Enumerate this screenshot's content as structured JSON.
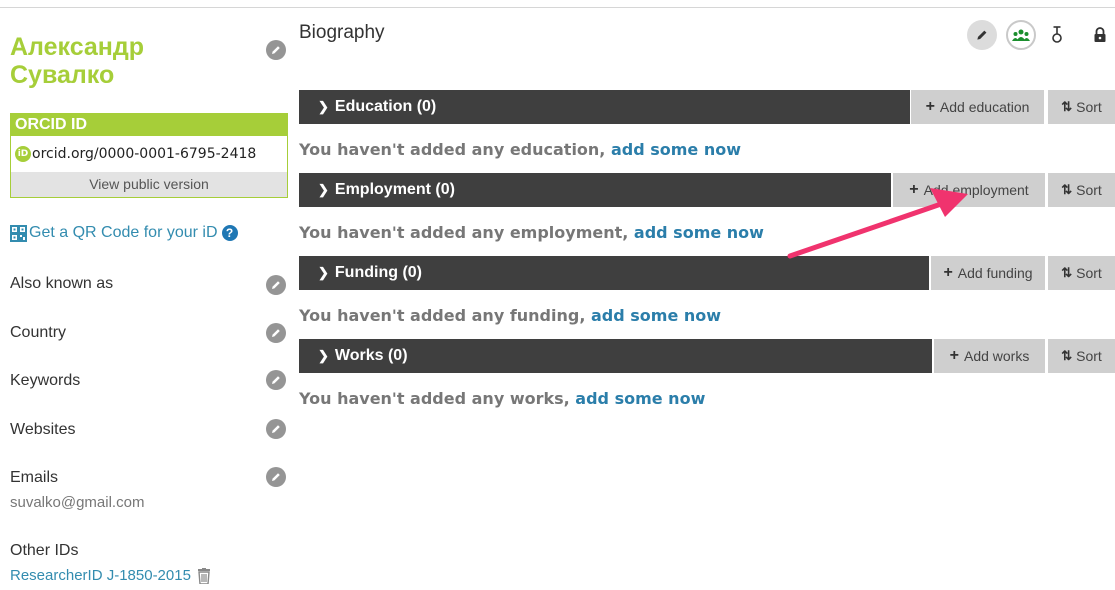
{
  "profile": {
    "name": "Александр Сувалко",
    "orcid_label": "ORCID ID",
    "orcid_url": "orcid.org/0000-0001-6795-2418",
    "view_public": "View public version",
    "qr_text": "Get a QR Code for your iD",
    "also_known_as": "Also known as",
    "country": "Country",
    "keywords": "Keywords",
    "websites": "Websites",
    "emails": "Emails",
    "email_value": "suvalko@gmail.com",
    "other_ids": "Other IDs",
    "researcher_id": "ResearcherID J-1850-2015"
  },
  "main": {
    "biography": "Biography",
    "sections": [
      {
        "title": "Education (0)",
        "add": "Add education",
        "sort": "Sort",
        "empty_prefix": "You haven't added any education, ",
        "empty_link": "add some now"
      },
      {
        "title": "Employment (0)",
        "add": "Add employment",
        "sort": "Sort",
        "empty_prefix": "You haven't added any employment, ",
        "empty_link": "add some now"
      },
      {
        "title": "Funding (0)",
        "add": "Add funding",
        "sort": "Sort",
        "empty_prefix": "You haven't added any funding, ",
        "empty_link": "add some now"
      },
      {
        "title": "Works (0)",
        "add": "Add works",
        "sort": "Sort",
        "empty_prefix": "You haven't added any works, ",
        "empty_link": "add some now"
      }
    ]
  },
  "icons": {
    "edit": "pencil-icon",
    "privacy": [
      "pencil-icon",
      "everyone-icon",
      "limited-icon",
      "lock-icon"
    ],
    "trash": "trash-icon",
    "help": "help-icon",
    "qr": "qr-code-icon"
  },
  "colors": {
    "orcid_green": "#a6ce39",
    "section_bar": "#3f3f3f",
    "link_blue": "#2b7eaa",
    "annotation_arrow": "#f0336e"
  }
}
